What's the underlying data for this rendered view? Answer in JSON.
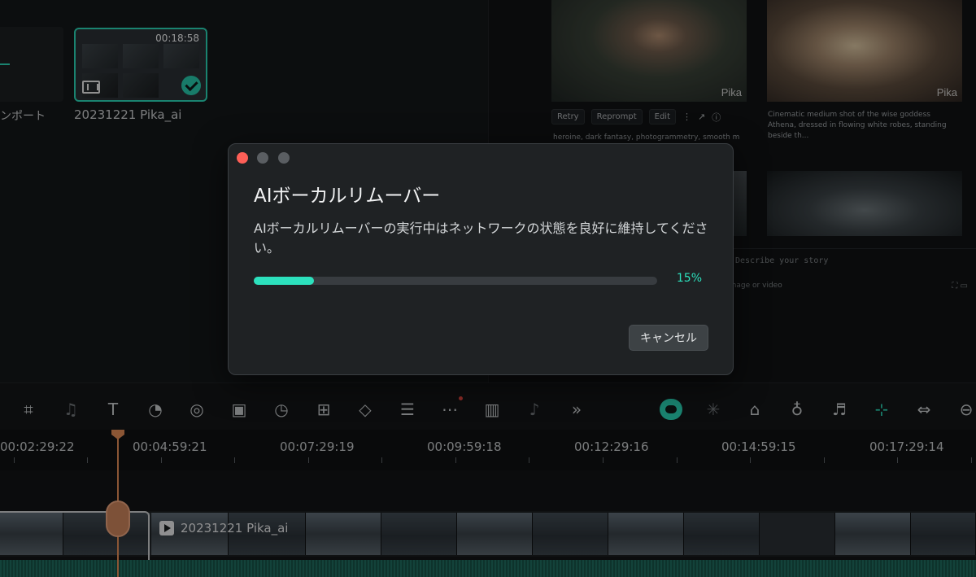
{
  "media": {
    "import_label": "ンポート",
    "clip": {
      "name": "20231221 Pika_ai",
      "duration": "00:18:58"
    }
  },
  "generator": {
    "watermark": "Pika",
    "actions": {
      "retry": "Retry",
      "reprompt": "Reprompt",
      "edit": "Edit"
    },
    "prompt_left": "heroine, dark fantasy, photogrammetry, smooth moveme",
    "prompt_right": "Cinematic medium shot of the wise goddess Athena, dressed in flowing white robes, standing beside th...",
    "story_placeholder": "Describe your story",
    "story_attach": "Image or video"
  },
  "timeline": {
    "timecodes": [
      "00:02:29:22",
      "00:04:59:21",
      "00:07:29:19",
      "00:09:59:18",
      "00:12:29:16",
      "00:14:59:15",
      "00:17:29:14"
    ],
    "track_clip_name": "20231221 Pika_ai"
  },
  "modal": {
    "title": "AIボーカルリムーバー",
    "message": "AIボーカルリムーバーの実行中はネットワークの状態を良好に維持してください。",
    "progress_percent": 15,
    "progress_label": "15%",
    "cancel_label": "キャンセル",
    "accent_color": "#2ce1bd"
  }
}
